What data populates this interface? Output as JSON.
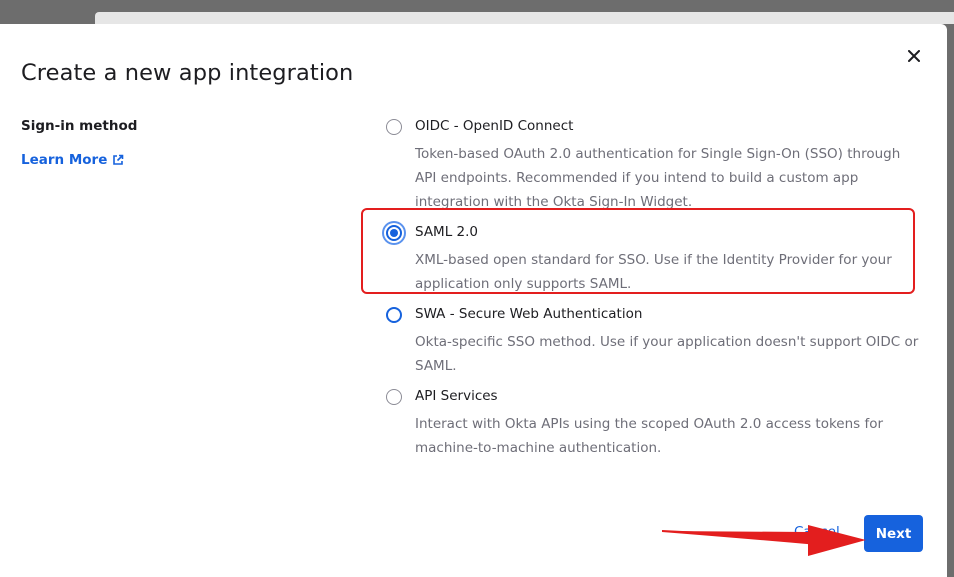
{
  "modal": {
    "title": "Create a new app integration",
    "close_icon": "close-icon",
    "sign_in_label": "Sign-in method",
    "learn_more": "Learn More",
    "external_icon": "external-link-icon"
  },
  "options": [
    {
      "title": "OIDC - OpenID Connect",
      "description": "Token-based OAuth 2.0 authentication for Single Sign-On (SSO) through API endpoints. Recommended if you intend to build a custom app integration with the Okta Sign-In Widget.",
      "state": "unselected"
    },
    {
      "title": "SAML 2.0",
      "description": "XML-based open standard for SSO. Use if the Identity Provider for your application only supports SAML.",
      "state": "selected"
    },
    {
      "title": "SWA - Secure Web Authentication",
      "description": "Okta-specific SSO method. Use if your application doesn't support OIDC or SAML.",
      "state": "unselected"
    },
    {
      "title": "API Services",
      "description": "Interact with Okta APIs using the scoped OAuth 2.0 access tokens for machine-to-machine authentication.",
      "state": "unselected"
    }
  ],
  "footer": {
    "cancel_label": "Cancel",
    "next_label": "Next"
  },
  "colors": {
    "primary": "#1662dd",
    "annotation": "#e31e1e"
  }
}
